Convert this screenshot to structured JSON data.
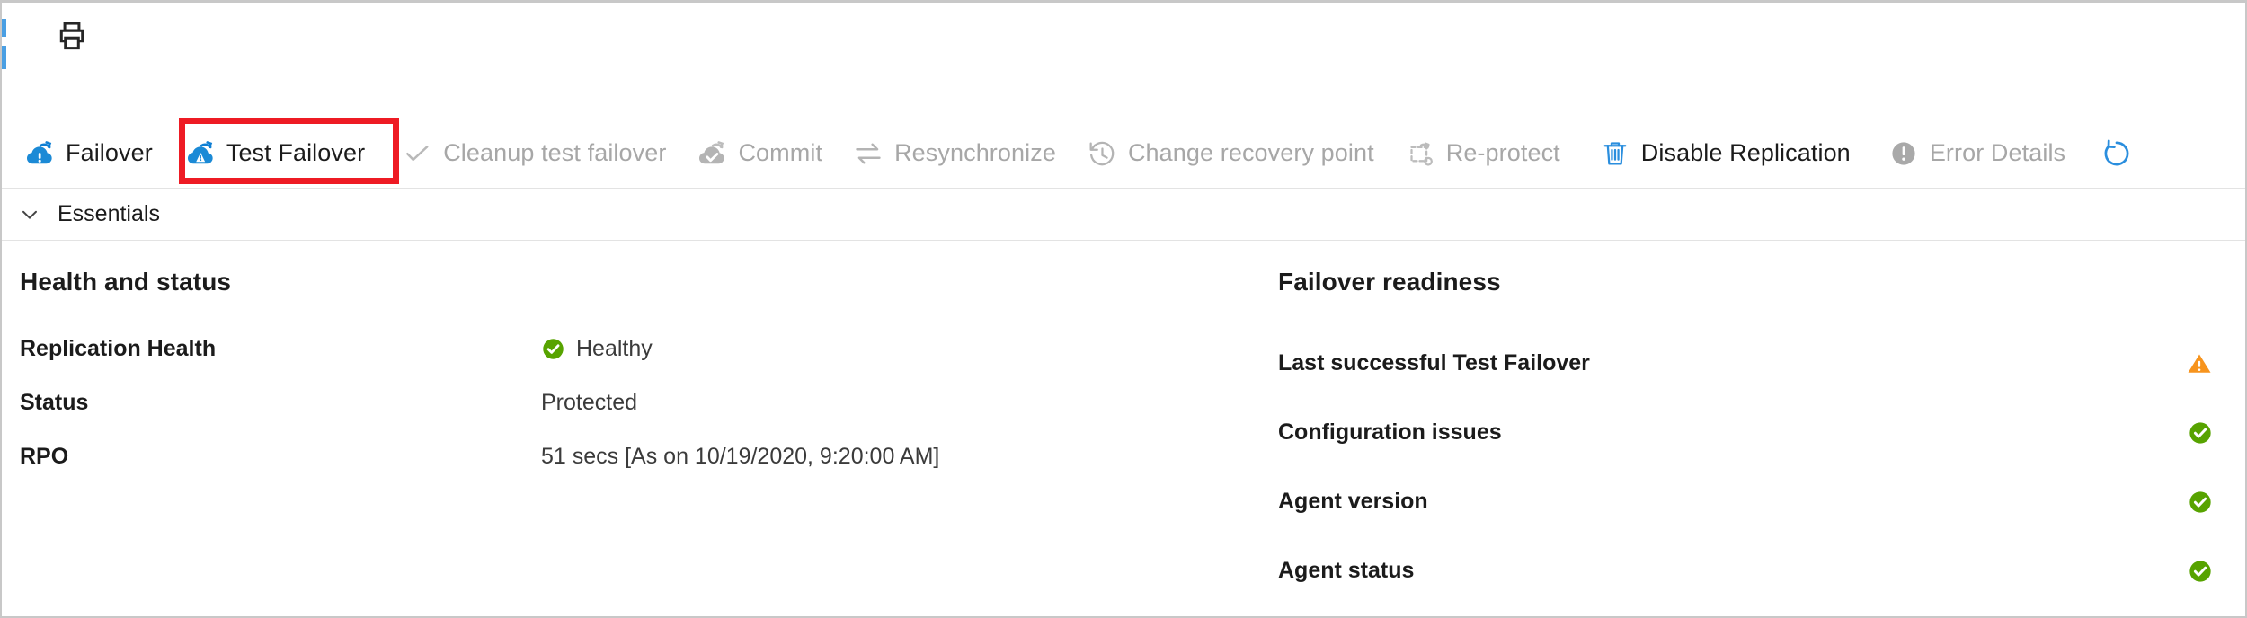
{
  "window": {
    "accent_blue": "#0078d4",
    "highlight_red": "#ee1b24",
    "disabled_gray": "#a7a7a7",
    "healthy_green": "#57a300",
    "warning_orange": "#f7941d"
  },
  "top_bar": {
    "print_button": {
      "icon": "print-icon",
      "tooltip": "Print"
    }
  },
  "command_bar": {
    "commands": [
      {
        "id": "failover",
        "label": "Failover",
        "icon": "cloud-failover-icon",
        "enabled": true,
        "highlighted": false
      },
      {
        "id": "test-failover",
        "label": "Test Failover",
        "icon": "cloud-failover-icon",
        "enabled": true,
        "highlighted": true
      },
      {
        "id": "cleanup-test-failover",
        "label": "Cleanup test failover",
        "icon": "check-icon",
        "enabled": false,
        "highlighted": false
      },
      {
        "id": "commit",
        "label": "Commit",
        "icon": "cloud-check-icon",
        "enabled": false,
        "highlighted": false
      },
      {
        "id": "resynchronize",
        "label": "Resynchronize",
        "icon": "sync-arrows-icon",
        "enabled": false,
        "highlighted": false
      },
      {
        "id": "change-recovery-point",
        "label": "Change recovery point",
        "icon": "clock-history-icon",
        "enabled": false,
        "highlighted": false
      },
      {
        "id": "re-protect",
        "label": "Re-protect",
        "icon": "reprotect-icon",
        "enabled": false,
        "highlighted": false
      },
      {
        "id": "disable-replication",
        "label": "Disable Replication",
        "icon": "trash-icon",
        "enabled": true,
        "highlighted": false
      },
      {
        "id": "error-details",
        "label": "Error Details",
        "icon": "error-circle-icon",
        "enabled": false,
        "highlighted": false
      }
    ],
    "refresh": {
      "label": "",
      "icon": "refresh-icon",
      "enabled": true
    }
  },
  "essentials": {
    "label": "Essentials",
    "expanded": true,
    "chevron_icon": "chevron-down-icon"
  },
  "health_and_status": {
    "title": "Health and status",
    "rows": [
      {
        "key": "Replication Health",
        "value": "Healthy",
        "status_icon": "green-check-icon"
      },
      {
        "key": "Status",
        "value": "Protected",
        "status_icon": ""
      },
      {
        "key": "RPO",
        "value": "51 secs [As on 10/19/2020, 9:20:00 AM]",
        "status_icon": ""
      }
    ]
  },
  "failover_readiness": {
    "title": "Failover readiness",
    "rows": [
      {
        "key": "Last successful Test Failover",
        "status_icon": "orange-warning-icon"
      },
      {
        "key": "Configuration issues",
        "status_icon": "green-check-icon"
      },
      {
        "key": "Agent version",
        "status_icon": "green-check-icon"
      },
      {
        "key": "Agent status",
        "status_icon": "green-check-icon"
      }
    ]
  }
}
